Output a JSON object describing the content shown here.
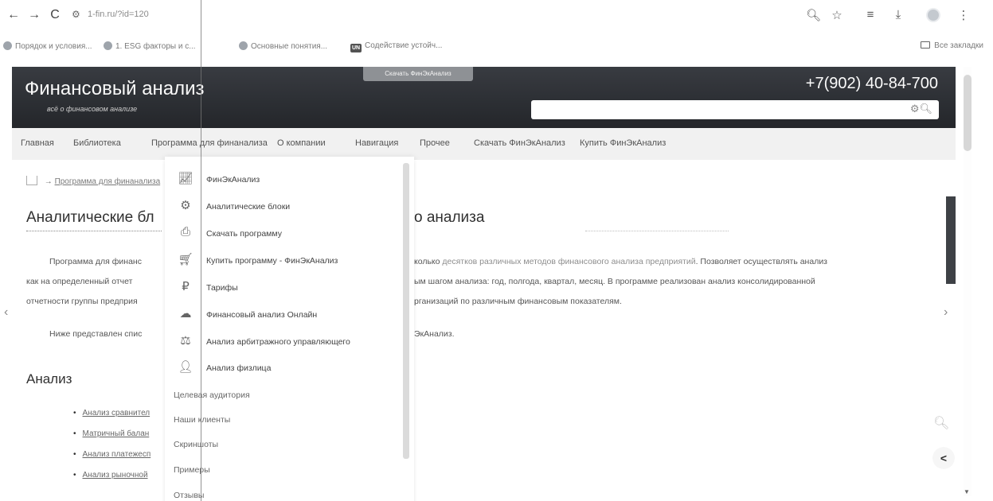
{
  "browser": {
    "url": "1-fin.ru/?id=120",
    "nav": {
      "back": "←",
      "forward": "→",
      "reload": "C"
    },
    "bookmarks": [
      {
        "label": "Порядок и условия...",
        "icon": "globe-icon"
      },
      {
        "label": "1. ESG факторы и с...",
        "icon": "globe-icon"
      },
      {
        "label": "Основные понятия...",
        "icon": "globe-icon"
      },
      {
        "label": "Содействие устойч...",
        "icon": "un-icon",
        "badge": "UN"
      }
    ],
    "all_bookmarks": "Все закладки"
  },
  "site": {
    "title": "Финансовый анализ",
    "subtitle": "всё о финансовом анализе",
    "download_tab": "Скачать ФинЭкАнализ",
    "phone": "+7(902) 40-84-700",
    "search_placeholder": ""
  },
  "mainnav": [
    "Главная",
    "Библиотека",
    "Программа для финанализа",
    "О компании",
    "Навигация",
    "Прочее",
    "Скачать ФинЭкАнализ",
    "Купить ФинЭкАнализ"
  ],
  "breadcrumb": {
    "arrow": "→",
    "current": "Программа для финанализа"
  },
  "page": {
    "title_left": "Аналитические бл",
    "title_right": "о анализа",
    "p1_a": "Программа для финанс",
    "p1_b": "колько",
    "p1_link": "десятков различных методов финансового анализа предприятий",
    "p1_c": ". Позволяет осуществлять анализ",
    "p2_a": "как на определенный отчет",
    "p2_b": "ым шагом анализа: год, полгода, квартал, месяц. В программе реализован анализ консолидированной",
    "p3_a": "отчетности группы предприя",
    "p3_b": "рганизаций по различным финансовым показателям.",
    "p4_a": "Ниже представлен спис",
    "p4_b": "ЭкАнализ.",
    "section_title": "Анализ",
    "bullets": [
      "Анализ сравнител",
      "Матричный балан",
      "Анализ платежесп",
      "Анализ рыночной"
    ]
  },
  "dropdown": {
    "items": [
      {
        "label": "ФинЭкАнализ",
        "icon": "chart-icon"
      },
      {
        "label": "Аналитические блоки",
        "icon": "gear-icon"
      },
      {
        "label": "Скачать программу",
        "icon": "download-icon"
      },
      {
        "label": "Купить программу - ФинЭкАнализ",
        "icon": "cart-icon"
      },
      {
        "label": "Тарифы",
        "icon": "tariff-icon"
      },
      {
        "label": "Финансовый анализ Онлайн",
        "icon": "cloud-icon"
      },
      {
        "label": "Анализ арбитражного управляющего",
        "icon": "scales-icon"
      },
      {
        "label": "Анализ физлица",
        "icon": "person-icon"
      }
    ],
    "plain_items": [
      "Целевая аудитория",
      "Наши клиенты",
      "Скриншоты",
      "Примеры",
      "Отзывы"
    ]
  },
  "colors": {
    "header_bg": "#2f333a",
    "nav_bg": "#ececec",
    "link": "#8a8a8a"
  }
}
